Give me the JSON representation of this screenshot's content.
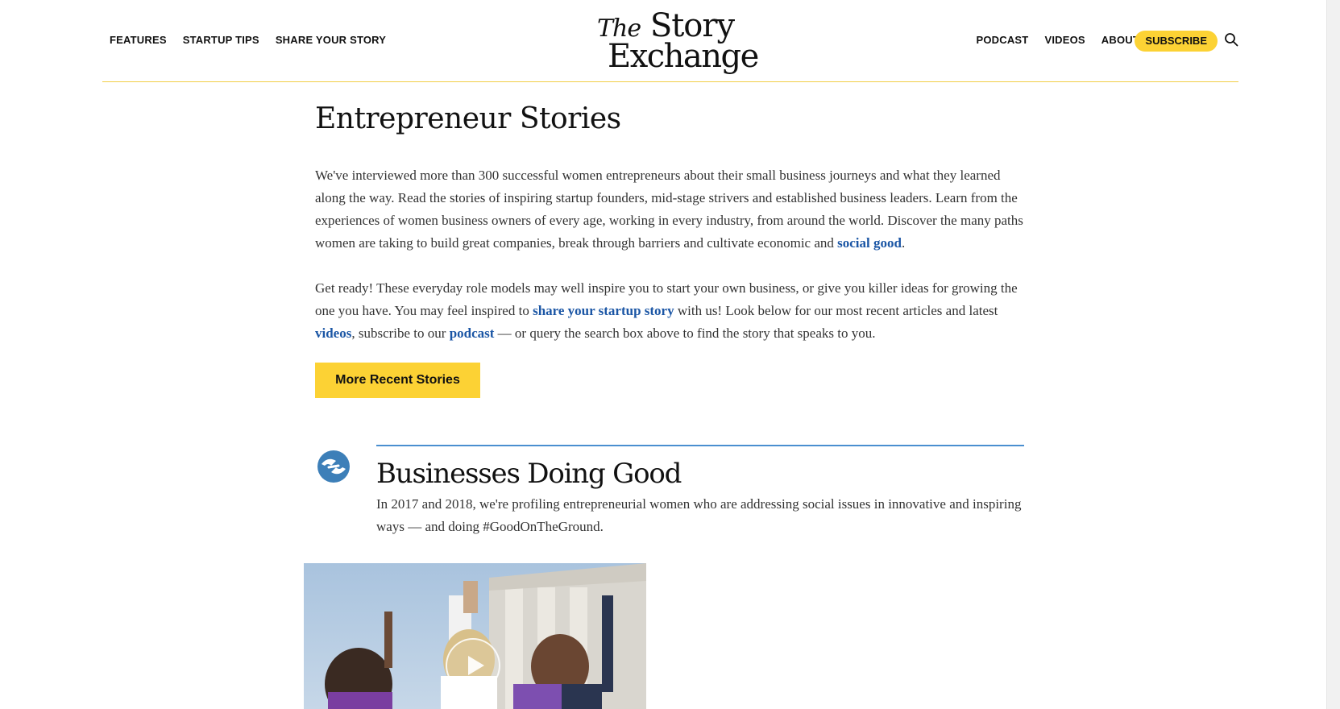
{
  "header": {
    "nav_left": [
      "FEATURES",
      "STARTUP TIPS",
      "SHARE YOUR STORY"
    ],
    "nav_right": [
      "PODCAST",
      "VIDEOS",
      "ABOUT"
    ],
    "subscribe_label": "SUBSCRIBE",
    "logo": {
      "the": "The",
      "story": "Story",
      "exchange": "Exchange"
    }
  },
  "intro": {
    "title": "Entrepreneur Stories",
    "p1_text": "We've interviewed more than 300 successful women entrepreneurs about their small business journeys and what they learned along the way. Read the stories of inspiring startup founders, mid-stage strivers and established business leaders. Learn from the experiences of women business owners of every age, working in every industry, from around the world. Discover the many paths women are taking to build great companies, break through barriers and cultivate economic and ",
    "p1_link": "social good",
    "p1_end": ".",
    "p2_a": "Get ready! These everyday role models may well inspire you to start your own business, or give you killer ideas for growing the one you have. You may feel inspired to ",
    "p2_link1": "share your startup story",
    "p2_b": " with us! Look below for our most recent articles and latest ",
    "p2_link2": "videos",
    "p2_c": ", subscribe to our ",
    "p2_link3": "podcast",
    "p2_d": " — or query the search box above to find the story that speaks to you.",
    "cta_label": "More Recent Stories"
  },
  "section": {
    "title": "Businesses Doing Good",
    "description": "In 2017 and 2018, we're profiling entrepreneurial women who are addressing social issues in innovative and inspiring ways — and doing #GoodOnTheGround."
  },
  "colors": {
    "accent_yellow": "#fcd234",
    "link_blue": "#1b56a5",
    "section_rule_blue": "#4a8fd0",
    "icon_blue": "#3d7fb8"
  }
}
